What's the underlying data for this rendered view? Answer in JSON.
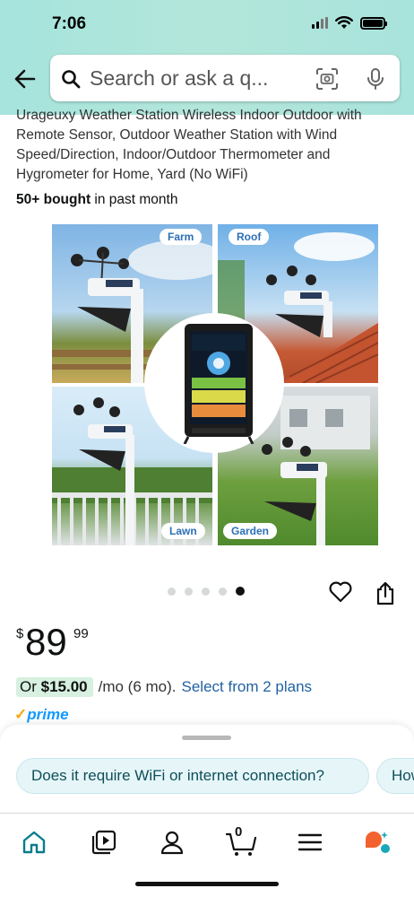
{
  "status_bar": {
    "time": "7:06"
  },
  "search": {
    "placeholder": "Search or ask a q..."
  },
  "product": {
    "title": "Urageuxy Weather Station Wireless Indoor Outdoor with Remote Sensor, Outdoor Weather Station with Wind Speed/Direction, Indoor/Outdoor Thermometer and Hygrometer for Home, Yard (No WiFi)",
    "bought_bold": "50+ bought",
    "bought_rest": " in past month",
    "image_tags": [
      "Farm",
      "Roof",
      "Lawn",
      "Garden"
    ],
    "image_count": 5,
    "image_active_index": 4
  },
  "price": {
    "currency": "$",
    "whole": "89",
    "fraction": "99"
  },
  "plan": {
    "or_label": "Or ",
    "amount": "$15.00",
    "term": "/mo (6 mo).",
    "link": "Select from 2 plans"
  },
  "prime": {
    "check": "✓",
    "label": "prime"
  },
  "questions": [
    "Does it require WiFi or internet connection?",
    "How"
  ],
  "tabs": {
    "cart_count": "0",
    "icons": [
      "home-icon",
      "video-icon",
      "account-icon",
      "cart-icon",
      "menu-icon",
      "rufus-icon"
    ]
  },
  "colors": {
    "accent_teal": "#a6e4dd",
    "link_blue": "#2162a1",
    "prime_blue": "#1399ff",
    "prime_orange": "#f7a70c",
    "plan_green": "#d7f0e0"
  }
}
